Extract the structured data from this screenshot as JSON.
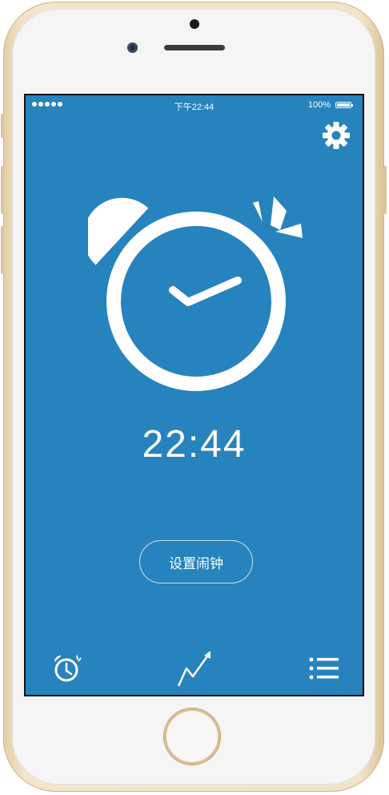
{
  "status_bar": {
    "time": "下午22:44",
    "battery_percent": "100%",
    "signal_icon": "signal-dots-icon",
    "battery_icon": "battery-icon",
    "battery_level": 1.0
  },
  "header": {
    "settings_icon": "gear-icon"
  },
  "clock": {
    "illustration_icon": "alarm-clock-icon",
    "time": "22:44"
  },
  "actions": {
    "set_alarm_label": "设置闹钟"
  },
  "tab_bar": {
    "items": [
      {
        "icon": "alarm-clock-icon",
        "name": "alarm"
      },
      {
        "icon": "trend-chart-icon",
        "name": "statistics"
      },
      {
        "icon": "list-icon",
        "name": "list"
      }
    ]
  },
  "colors": {
    "screen_background": "#2683bd",
    "foreground": "#ffffff",
    "phone_frame": "#f2e4c8"
  }
}
